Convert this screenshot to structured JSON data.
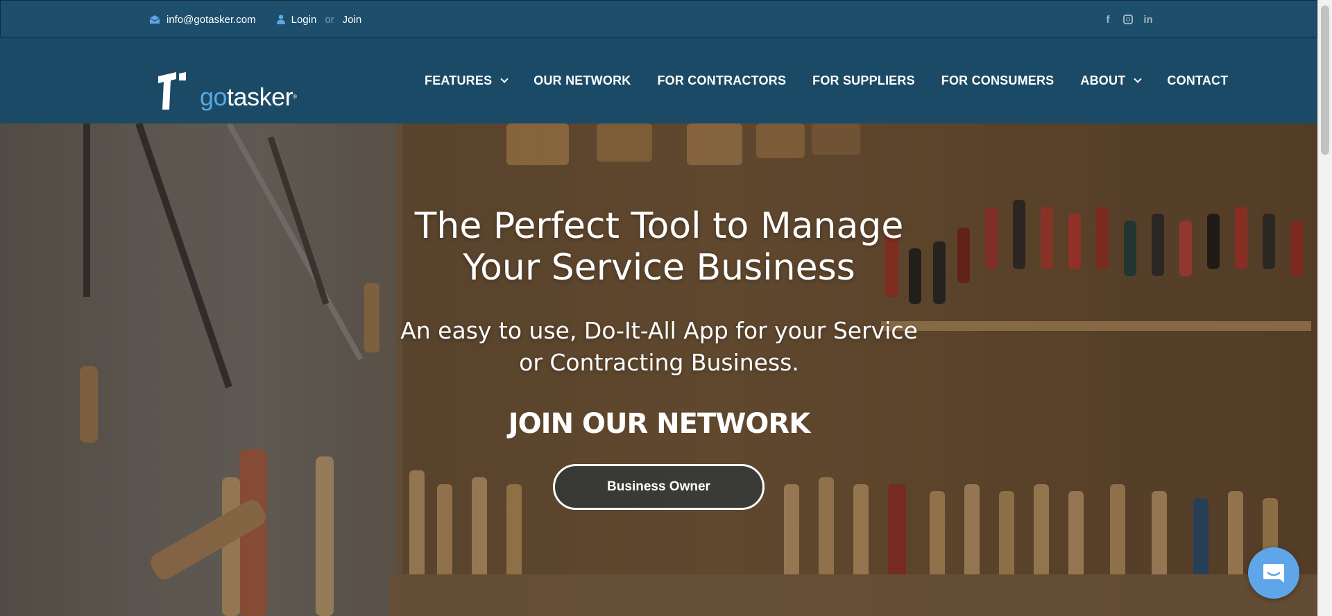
{
  "topbar": {
    "email": "info@gotasker.com",
    "login": "Login",
    "or": "or",
    "join": "Join",
    "social": [
      "facebook-icon",
      "instagram-icon",
      "linkedin-icon"
    ],
    "facebook_glyph": "f",
    "linkedin_glyph": "in"
  },
  "header": {
    "logo_go": "go",
    "logo_tasker": "tasker",
    "logo_mark": "®"
  },
  "nav": {
    "features": "FEATURES",
    "network": "OUR NETWORK",
    "contractors": "FOR CONTRACTORS",
    "suppliers": "FOR SUPPLIERS",
    "consumers": "FOR CONSUMERS",
    "about": "ABOUT",
    "contact": "CONTACT"
  },
  "hero": {
    "title_line1": "The Perfect Tool to Manage",
    "title_line2": "Your Service Business",
    "sub_line1": "An easy to use, Do-It-All App for your Service",
    "sub_line2": "or Contracting Business.",
    "join": "JOIN OUR NETWORK",
    "button": "Business Owner"
  },
  "colors": {
    "topbar_bg": "#1d4e6c",
    "header_bg": "#1b4a66",
    "brand_blue": "#59a7e0",
    "chat_bg": "#5ea6e8"
  }
}
